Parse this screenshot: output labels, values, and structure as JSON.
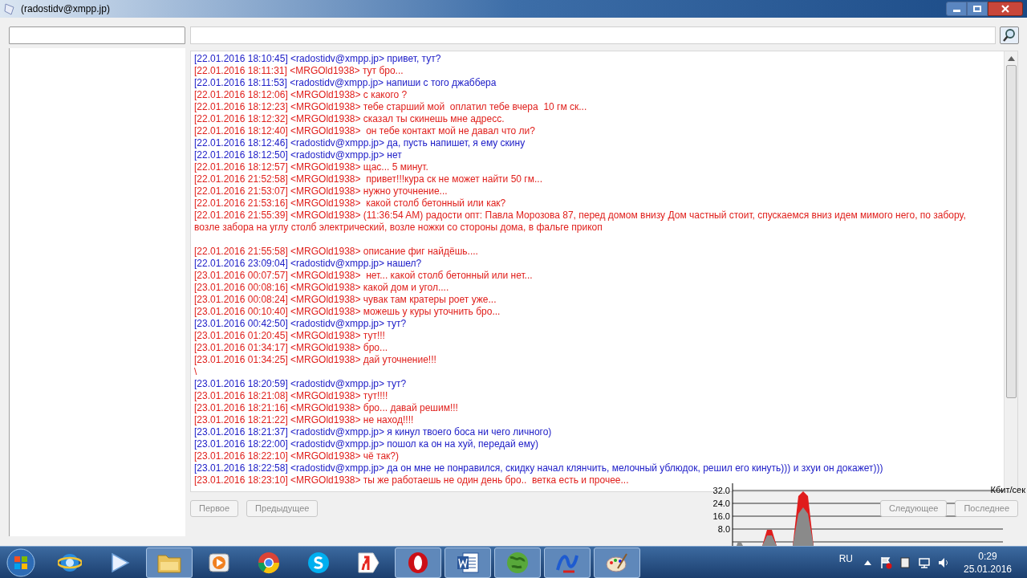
{
  "window": {
    "title": "(radostidv@xmpp.jp)"
  },
  "chat": {
    "lines": [
      {
        "kind": "me",
        "text": "[22.01.2016 18:10:45] <radostidv@xmpp.jp> привет, тут?"
      },
      {
        "kind": "peer",
        "text": "[22.01.2016 18:11:31] <MRGOld1938> тут бро..."
      },
      {
        "kind": "me",
        "text": "[22.01.2016 18:11:53] <radostidv@xmpp.jp> напиши с того джаббера"
      },
      {
        "kind": "peer",
        "text": "[22.01.2016 18:12:06] <MRGOld1938> с какого ?"
      },
      {
        "kind": "peer",
        "text": "[22.01.2016 18:12:23] <MRGOld1938> тебе старший мой  оплатил тебе вчера  10 гм ск..."
      },
      {
        "kind": "peer",
        "text": "[22.01.2016 18:12:32] <MRGOld1938> сказал ты скинешь мне адресс."
      },
      {
        "kind": "peer",
        "text": "[22.01.2016 18:12:40] <MRGOld1938>  он тебе контакт мой не давал что ли?"
      },
      {
        "kind": "me",
        "text": "[22.01.2016 18:12:46] <radostidv@xmpp.jp> да, пусть напишет, я ему скину"
      },
      {
        "kind": "me",
        "text": "[22.01.2016 18:12:50] <radostidv@xmpp.jp> нет"
      },
      {
        "kind": "peer",
        "text": "[22.01.2016 18:12:57] <MRGOld1938> щас... 5 минут."
      },
      {
        "kind": "peer",
        "text": "[22.01.2016 21:52:58] <MRGOld1938>  привет!!!кура ск не может найти 50 гм..."
      },
      {
        "kind": "peer",
        "text": "[22.01.2016 21:53:07] <MRGOld1938> нужно уточнение..."
      },
      {
        "kind": "peer",
        "text": "[22.01.2016 21:53:16] <MRGOld1938>  какой столб бетонный или как?"
      },
      {
        "kind": "peer",
        "text": "[22.01.2016 21:55:39] <MRGOld1938> (11:36:54 AM) радости опт: Павла Морозова 87, перед домом внизу Дом частный стоит, спускаемся вниз идем мимого него, по забору, возле забора на углу столб электрический, возле ножки со стороны дома, в фальге прикоп"
      },
      {
        "kind": "blank"
      },
      {
        "kind": "peer",
        "text": "[22.01.2016 21:55:58] <MRGOld1938> описание фиг найдёшь...."
      },
      {
        "kind": "me",
        "text": "[22.01.2016 23:09:04] <radostidv@xmpp.jp> нашел?"
      },
      {
        "kind": "peer",
        "text": "[23.01.2016 00:07:57] <MRGOld1938>  нет... какой столб бетонный или нет..."
      },
      {
        "kind": "peer",
        "text": "[23.01.2016 00:08:16] <MRGOld1938> какой дом и угол...."
      },
      {
        "kind": "peer",
        "text": "[23.01.2016 00:08:24] <MRGOld1938> чувак там кратеры роет уже..."
      },
      {
        "kind": "peer",
        "text": "[23.01.2016 00:10:40] <MRGOld1938> можешь у куры уточнить бро..."
      },
      {
        "kind": "me",
        "text": "[23.01.2016 00:42:50] <radostidv@xmpp.jp> тут?"
      },
      {
        "kind": "peer",
        "text": "[23.01.2016 01:20:45] <MRGOld1938> тут!!!"
      },
      {
        "kind": "peer",
        "text": "[23.01.2016 01:34:17] <MRGOld1938> бро..."
      },
      {
        "kind": "peer",
        "text": "[23.01.2016 01:34:25] <MRGOld1938> дай уточнение!!!"
      },
      {
        "kind": "peer",
        "text": "\\"
      },
      {
        "kind": "me",
        "text": "[23.01.2016 18:20:59] <radostidv@xmpp.jp> тут?"
      },
      {
        "kind": "peer",
        "text": "[23.01.2016 18:21:08] <MRGOld1938> тут!!!!"
      },
      {
        "kind": "peer",
        "text": "[23.01.2016 18:21:16] <MRGOld1938> бро... давай решим!!!"
      },
      {
        "kind": "peer",
        "text": "[23.01.2016 18:21:22] <MRGOld1938> не наход!!!!"
      },
      {
        "kind": "me",
        "text": "[23.01.2016 18:21:37] <radostidv@xmpp.jp> я кинул твоего боса ни чего личного)"
      },
      {
        "kind": "me",
        "text": "[23.01.2016 18:22:00] <radostidv@xmpp.jp> пошол ка он на хуй, передай ему)"
      },
      {
        "kind": "peer",
        "text": "[23.01.2016 18:22:10] <MRGOld1938> чё так?)"
      },
      {
        "kind": "me",
        "text": "[23.01.2016 18:22:58] <radostidv@xmpp.jp> да он мне не понравился, скидку начал клянчить, мелочный ублюдок, решил его кинуть))) и зхуи он докажет)))"
      },
      {
        "kind": "peer",
        "text": "[23.01.2016 18:23:10] <MRGOld1938> ты же работаешь не один день бро..  ветка есть и прочее..."
      }
    ]
  },
  "nav_buttons": [
    {
      "label": "Первое",
      "disabled": true
    },
    {
      "label": "Предыдущее",
      "disabled": true
    },
    {
      "label": "Следующее",
      "disabled": true
    },
    {
      "label": "Последнее",
      "disabled": true
    }
  ],
  "traffic": {
    "unit": "Кбит/сек",
    "ticks": [
      "32.0",
      "24.0",
      "16.0",
      "8.0"
    ]
  },
  "taskbar": {
    "items": [
      {
        "kind": "browser",
        "open": false
      },
      {
        "kind": "player",
        "open": false
      },
      {
        "kind": "folder",
        "open": true
      },
      {
        "kind": "media",
        "open": false
      },
      {
        "kind": "chrome",
        "open": false
      },
      {
        "kind": "skype",
        "open": false
      },
      {
        "kind": "yandex",
        "open": false
      },
      {
        "kind": "opera",
        "open": true
      },
      {
        "kind": "word",
        "open": true
      },
      {
        "kind": "globe",
        "open": true
      },
      {
        "kind": "plus",
        "open": true
      },
      {
        "kind": "paint",
        "open": true
      }
    ],
    "language": "RU",
    "time": "0:29",
    "date": "25.01.2016"
  }
}
